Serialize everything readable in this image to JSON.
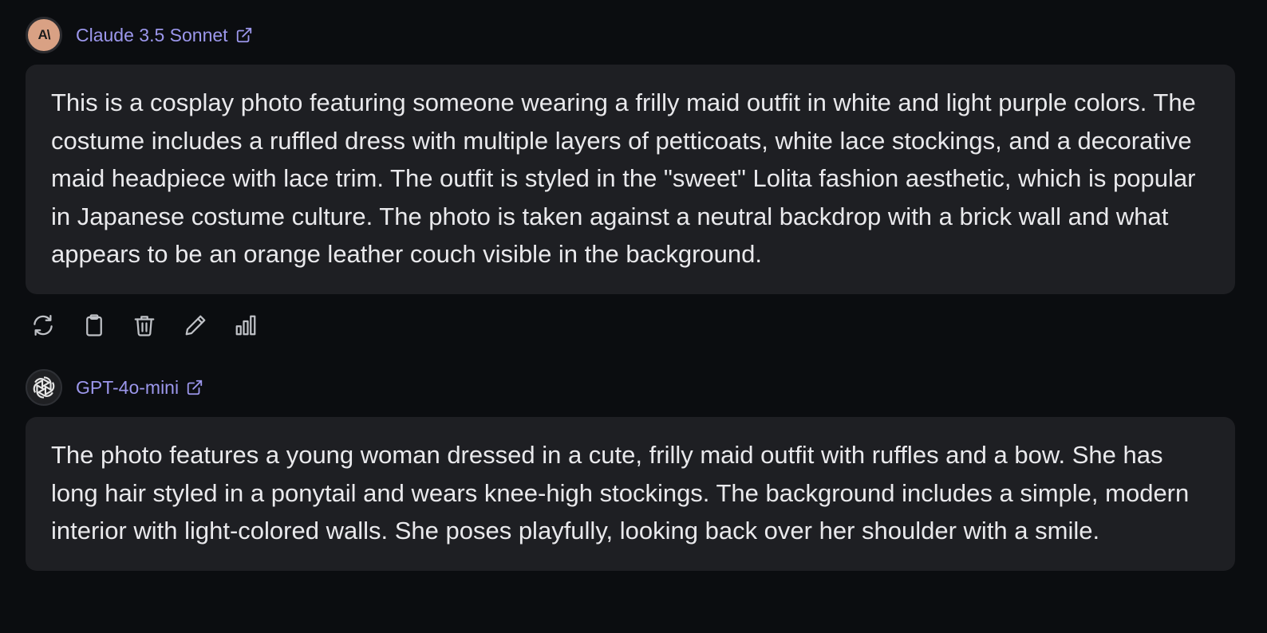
{
  "messages": [
    {
      "model_name": "Claude 3.5 Sonnet",
      "avatar_text": "A\\",
      "avatar_icon": "anthropic-logo-icon",
      "link_icon": "external-link-icon",
      "text": "This is a cosplay photo featuring someone wearing a frilly maid outfit in white and light purple colors. The costume includes a ruffled dress with multiple layers of petticoats, white lace stockings, and a decorative maid headpiece with lace trim. The outfit is styled in the \"sweet\" Lolita fashion aesthetic, which is popular in Japanese costume culture. The photo is taken against a neutral backdrop with a brick wall and what appears to be an orange leather couch visible in the background."
    },
    {
      "model_name": "GPT-4o-mini",
      "avatar_icon": "openai-logo-icon",
      "link_icon": "external-link-icon",
      "text": "The photo features a young woman dressed in a cute, frilly maid outfit with ruffles and a bow. She has long hair styled in a ponytail and wears knee-high stockings. The background includes a simple, modern interior with light-colored walls. She poses playfully, looking back over her shoulder with a smile."
    }
  ],
  "actions": [
    {
      "name": "regenerate-button",
      "icon": "refresh-icon"
    },
    {
      "name": "copy-button",
      "icon": "clipboard-icon"
    },
    {
      "name": "delete-button",
      "icon": "trash-icon"
    },
    {
      "name": "edit-button",
      "icon": "pencil-icon"
    },
    {
      "name": "stats-button",
      "icon": "bar-chart-icon"
    }
  ],
  "colors": {
    "background": "#0b0d10",
    "bubble": "#1e1f23",
    "link": "#9c97ec",
    "text": "#e9e9ec",
    "claude_avatar": "#d9a184"
  }
}
